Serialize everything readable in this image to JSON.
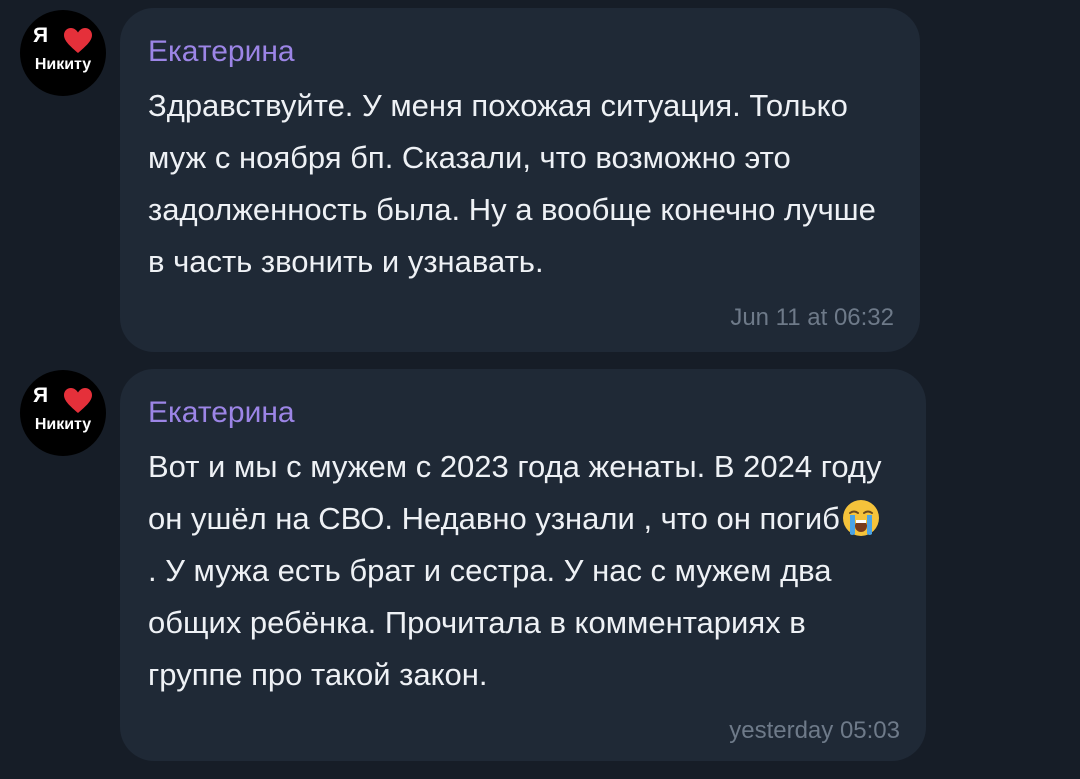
{
  "avatar": {
    "line1": "Я",
    "line2": "Никиту",
    "heart_color": "#e5303a"
  },
  "messages": [
    {
      "sender": "Екатерина",
      "text": "Здравствуйте. У меня похожая ситуация. Только муж с ноября бп. Сказали, что возможно это задолженность была. Ну а вообще конечно лучше в часть звонить и узнавать.",
      "time": "Jun 11 at 06:32"
    },
    {
      "sender": "Екатерина",
      "text_before_emoji": "Вот и мы с мужем с 2023 года женаты. В 2024 году он ушёл на СВО. Недавно узнали , что он погиб",
      "emoji": "loudly-crying-face-emoji",
      "text_after_emoji": ". У мужа есть брат и сестра. У нас с мужем два общих ребёнка. Прочитала в комментариях в группе про такой закон.",
      "time": "yesterday 05:03"
    }
  ],
  "colors": {
    "background": "#161d27",
    "bubble": "#1f2936",
    "sender": "#9c85e6",
    "text": "#eef1f5",
    "time": "#6e7a89"
  }
}
